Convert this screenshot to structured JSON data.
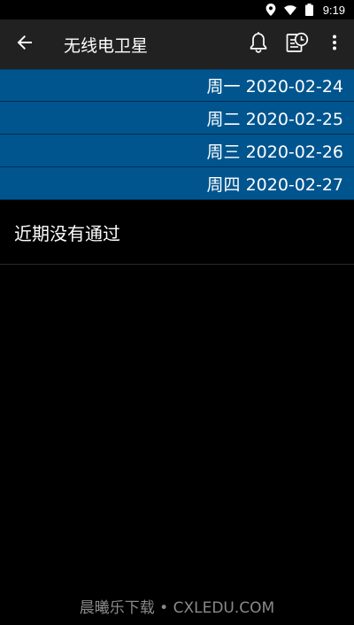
{
  "status_bar": {
    "time": "9:19",
    "icons": [
      "location-icon",
      "wifi-icon",
      "battery-icon"
    ]
  },
  "app_bar": {
    "title": "无线电卫星",
    "back_icon": "arrow-back-icon",
    "actions": [
      "bell-icon",
      "schedule-list-icon",
      "more-vert-icon"
    ]
  },
  "dates": [
    {
      "label": "周一 2020-02-24"
    },
    {
      "label": "周二 2020-02-25"
    },
    {
      "label": "周三 2020-02-26"
    },
    {
      "label": "周四 2020-02-27"
    }
  ],
  "empty_message": "近期没有通过",
  "watermark": "晨曦乐下载 • CXLEDU.COM",
  "colors": {
    "app_bar_bg": "#212121",
    "date_row_bg": "#00558f",
    "background": "#000000"
  }
}
